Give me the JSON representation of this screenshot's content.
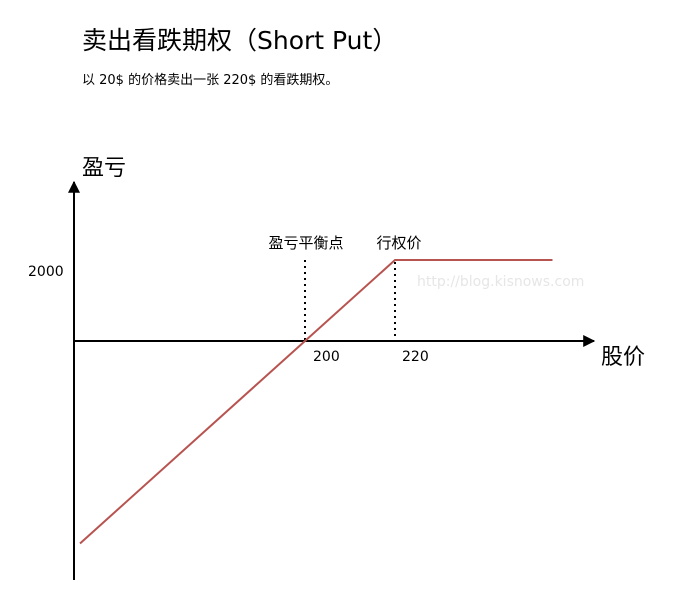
{
  "header": {
    "title": "卖出看跌期权（Short Put）",
    "subtitle": "以 20$ 的价格卖出一张 220$ 的看跌期权。"
  },
  "colors": {
    "payoff_line": "#b85450",
    "axis": "#000000",
    "watermark": "#e6e6e6"
  },
  "watermark": "http://blog.kisnows.com",
  "chart_data": {
    "type": "line",
    "title": "卖出看跌期权（Short Put）",
    "subtitle": "以 20$ 的价格卖出一张 220$ 的看跌期权。",
    "xlabel": "股价",
    "ylabel": "盈亏",
    "x_ticks": [
      "200",
      "220"
    ],
    "y_ticks": [
      "2000"
    ],
    "annotations": [
      {
        "label": "盈亏平衡点",
        "x": 200
      },
      {
        "label": "行权价",
        "x": 220
      }
    ],
    "series": [
      {
        "points": [
          {
            "x": 150,
            "y": -5000
          },
          {
            "x": 200,
            "y": 0
          },
          {
            "x": 220,
            "y": 2000
          },
          {
            "x": 255,
            "y": 2000
          }
        ]
      }
    ],
    "grid": false
  }
}
